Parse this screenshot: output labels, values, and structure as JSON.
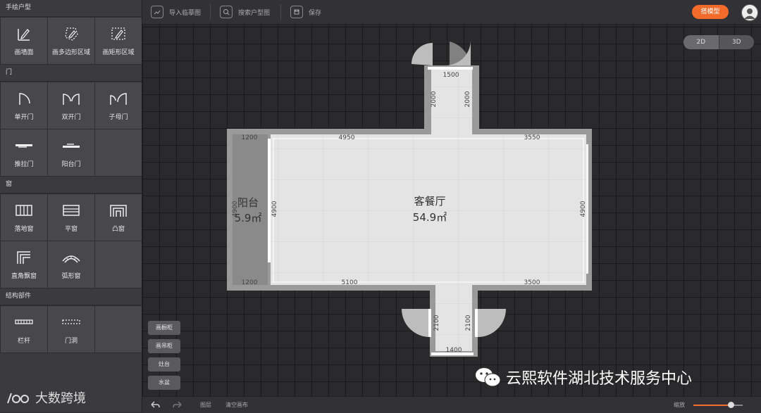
{
  "sidebar": {
    "sections": [
      {
        "title": "手绘户型",
        "items": [
          {
            "label": "画墙面",
            "icon": "pencil-wall-icon"
          },
          {
            "label": "画多边形区域",
            "icon": "polygon-area-icon"
          },
          {
            "label": "画矩形区域",
            "icon": "rect-area-icon"
          }
        ]
      },
      {
        "title": "门",
        "items": [
          {
            "label": "单开门",
            "icon": "single-door-icon"
          },
          {
            "label": "双开门",
            "icon": "double-door-icon"
          },
          {
            "label": "子母门",
            "icon": "mother-child-door-icon"
          },
          {
            "label": "推拉门",
            "icon": "sliding-door-icon"
          },
          {
            "label": "阳台门",
            "icon": "balcony-door-icon"
          }
        ]
      },
      {
        "title": "窗",
        "items": [
          {
            "label": "落地窗",
            "icon": "floor-window-icon"
          },
          {
            "label": "平窗",
            "icon": "flat-window-icon"
          },
          {
            "label": "凸窗",
            "icon": "bay-window-icon"
          },
          {
            "label": "直角飘窗",
            "icon": "corner-window-icon"
          },
          {
            "label": "弧形窗",
            "icon": "arc-window-icon"
          }
        ]
      },
      {
        "title": "结构部件",
        "items": [
          {
            "label": "栏杆",
            "icon": "railing-icon"
          },
          {
            "label": "门洞",
            "icon": "door-opening-icon"
          }
        ]
      }
    ]
  },
  "toolbar": {
    "import_label": "导入临摹图",
    "search_label": "搜索户型图",
    "save_label": "保存",
    "build_label": "搭模型"
  },
  "view_toggle": {
    "d2": "2D",
    "d3": "3D"
  },
  "side_buttons": [
    "画橱柜",
    "画吊柜",
    "灶台",
    "水盆"
  ],
  "bottombar": {
    "layer_label": "图层",
    "clear_label": "清空画布",
    "zoom_label": "缩放",
    "zoom_level": 0.75
  },
  "floorplan": {
    "living_room_name": "客餐厅",
    "living_room_area": "54.9㎡",
    "balcony_name": "阳台",
    "balcony_area": "5.9㎡",
    "dimensions": {
      "top_corridor_width": "1500",
      "top_corridor_left": "2000",
      "top_corridor_right": "2000",
      "main_top_left": "4950",
      "main_top_right": "3550",
      "balcony_top": "1200",
      "main_left_height": "4900",
      "main_right_height": "4900",
      "balcony_left": "4900",
      "balcony_bottom": "1200",
      "main_bottom_left": "5100",
      "main_bottom_right": "3500",
      "bottom_corridor_left": "2100",
      "bottom_corridor_right": "2100",
      "bottom_corridor_width": "1400"
    }
  },
  "watermarks": {
    "left": "大数跨境",
    "right": "云熙软件湖北技术服务中心"
  },
  "colors": {
    "accent": "#f26b2b",
    "wall": "#9a9a9a",
    "floor": "#e8e8e8"
  }
}
